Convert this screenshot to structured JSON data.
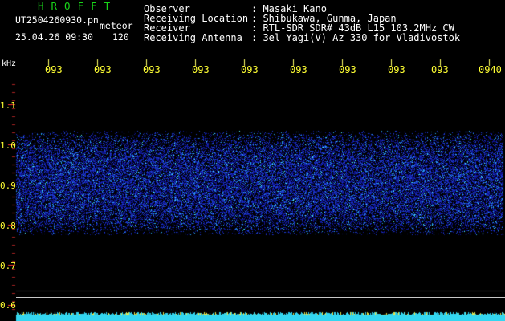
{
  "header": {
    "logo": "HROFFT",
    "filename": "UT2504260930.pn",
    "subtitle": "meteor",
    "datetime": "25.04.26 09:30",
    "number": "120"
  },
  "meta": [
    {
      "key": "Observer",
      "value": ": Masaki Kano"
    },
    {
      "key": "Receiving Location",
      "value": ": Shibukawa, Gunma, Japan"
    },
    {
      "key": "Receiver",
      "value": ": RTL-SDR SDR# 43dB L15 103.2MHz CW"
    },
    {
      "key": "Receiving Antenna",
      "value": ": 3el Yagi(V) Az 330 for Vladivostok"
    }
  ],
  "axis": {
    "unit": "kHz",
    "x_labels": [
      "093",
      "093",
      "093",
      "093",
      "093",
      "093",
      "093",
      "093",
      "093",
      "0940"
    ],
    "y_labels": [
      "1.1",
      "1.0",
      "0.9",
      "0.8",
      "0.7",
      "0.6"
    ]
  },
  "colors": {
    "background": "#000000",
    "label": "#ffff33",
    "noise_dark": "#1a1ab0",
    "noise_bright": "#33e6ff",
    "logo": "#19d419"
  }
}
